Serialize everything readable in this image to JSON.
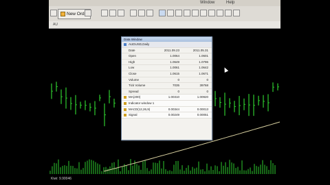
{
  "menu": {
    "window_label": "Window",
    "help_label": "Help"
  },
  "toolbar": {
    "new_order_label": "New Order"
  },
  "tabs": {
    "label": "AU"
  },
  "data_window": {
    "title": "Data Window",
    "symbol": "AUDUSD,Daily",
    "rows": [
      {
        "label": "Date",
        "v1": "2011.09.23",
        "v2": "2011.05.31",
        "type": "hdr"
      },
      {
        "label": "Open",
        "v1": "1.0064",
        "v2": "1.0601",
        "type": "row"
      },
      {
        "label": "High",
        "v1": "1.0649",
        "v2": "1.0796",
        "type": "row"
      },
      {
        "label": "Low",
        "v1": "1.0061",
        "v2": "1.0642",
        "type": "row"
      },
      {
        "label": "Close",
        "v1": "1.0615",
        "v2": "1.0671",
        "type": "row"
      },
      {
        "label": "Volume",
        "v1": "0",
        "v2": "0",
        "type": "row"
      },
      {
        "label": "Tick Volume",
        "v1": "7035",
        "v2": "39768",
        "type": "row"
      },
      {
        "label": "Spread",
        "v1": "0",
        "v2": "0",
        "type": "row"
      },
      {
        "label": "MA(200)",
        "v1": "1.00310",
        "v2": "1.00920",
        "type": "sec"
      },
      {
        "label": "Indicator window 1",
        "v1": "",
        "v2": "",
        "type": "sec"
      },
      {
        "label": "MACD(12,26,9)",
        "v1": "0.00344",
        "v2": "0.00013",
        "type": "sec"
      },
      {
        "label": "Signal",
        "v1": "0.00249",
        "v2": "0.00051",
        "type": "sec"
      }
    ]
  },
  "status": {
    "text": "Kiwi: 9.90046"
  },
  "colors": {
    "candle": "#2ecc2e",
    "ma_line": "#d8d0a0",
    "volume": "#2ecc2e"
  }
}
